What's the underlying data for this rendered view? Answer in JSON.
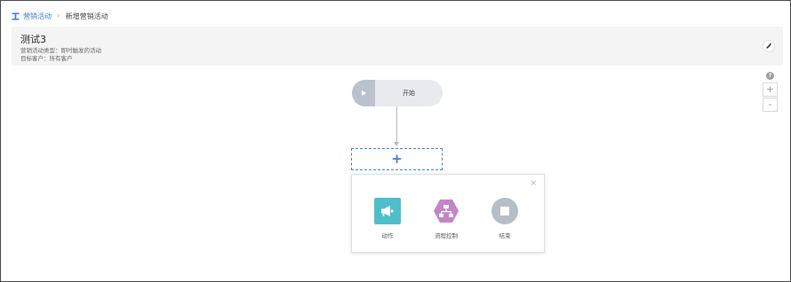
{
  "breadcrumb": {
    "icon": "campaign-icon",
    "link": "营销活动",
    "current": "新增营销活动"
  },
  "header": {
    "title": "测试3",
    "campaign_type": "营销活动类型：即时触发的活动",
    "target_customers": "目标客户：所有客户"
  },
  "canvas": {
    "zoom_in": "+",
    "zoom_out": "-",
    "help": "?",
    "start_node": {
      "label": "开始"
    },
    "add_node": {
      "label": "+"
    },
    "popup": {
      "close": "×",
      "options": [
        {
          "label": "动作",
          "icon": "megaphone-icon",
          "color": "#4cbfca"
        },
        {
          "label": "流程控制",
          "icon": "flow-control-icon",
          "color": "#c384c8"
        },
        {
          "label": "结束",
          "icon": "stop-icon",
          "color": "#b5bdc8"
        }
      ]
    }
  },
  "colors": {
    "accent": "#3d7be0",
    "header_bg": "#f4f4f4",
    "start_node_bg": "#e7eaef"
  }
}
